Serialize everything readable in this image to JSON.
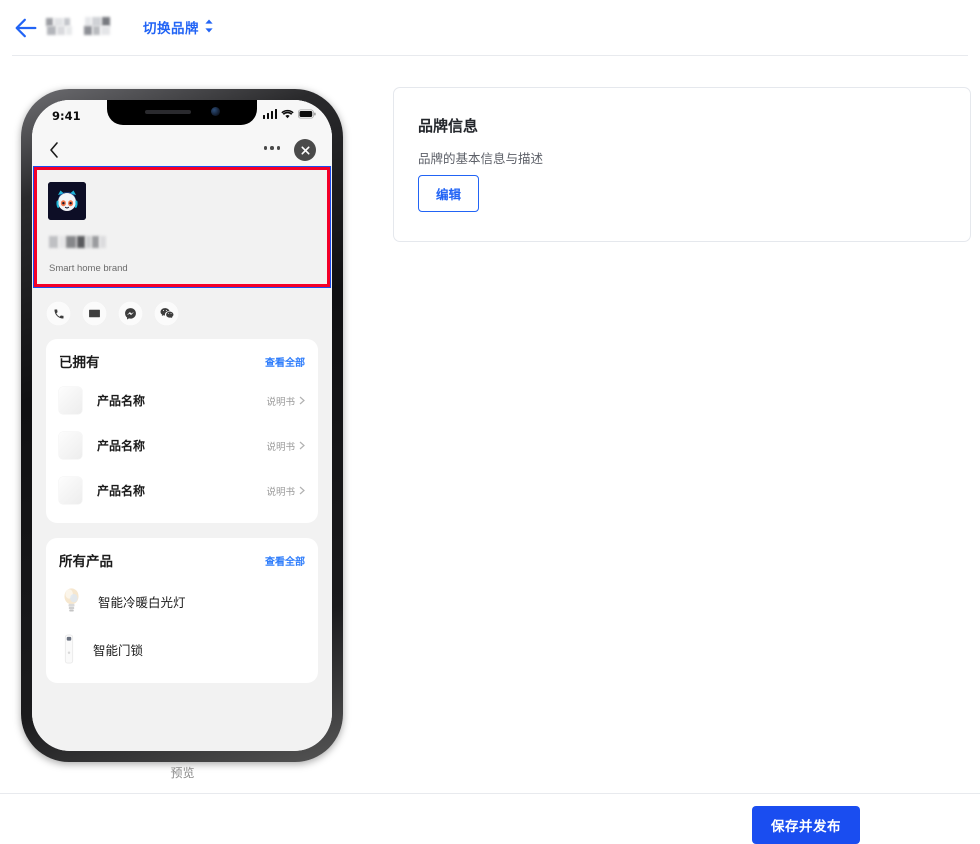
{
  "header": {
    "back_icon": "arrow-left-icon",
    "brand_logo_placeholder": "blurred-logo",
    "brand_text_placeholder": "blurred-brand-text",
    "switch_brand_label": "切换品牌",
    "switch_brand_icon": "unfold-more-icon",
    "accent_color": "#2264f5"
  },
  "preview": {
    "caption": "预览",
    "phone": {
      "status_bar": {
        "time": "9:41",
        "signal_icon": "cellular-signal-icon",
        "wifi_icon": "wifi-icon",
        "battery_icon": "battery-full-icon"
      },
      "nav": {
        "back_icon": "chevron-left-icon",
        "more_icon": "more-horizontal-icon",
        "close_icon": "close-circle-icon"
      },
      "brand_header": {
        "avatar_icon": "brand-avatar-cat-helmet",
        "name_placeholder": "blurred-brand-name",
        "description": "Smart home brand",
        "highlight_border_color": "#f40028",
        "highlight_outline_color": "#1a4df0"
      },
      "contacts": [
        {
          "icon": "phone-icon",
          "label": "电话"
        },
        {
          "icon": "email-icon",
          "label": "邮件"
        },
        {
          "icon": "messenger-icon",
          "label": "Messenger"
        },
        {
          "icon": "wechat-icon",
          "label": "微信"
        }
      ],
      "owned_section": {
        "title": "已拥有",
        "view_all": "查看全部",
        "items": [
          {
            "name": "产品名称",
            "action": "说明书",
            "chevron": "chevron-right-icon"
          },
          {
            "name": "产品名称",
            "action": "说明书",
            "chevron": "chevron-right-icon"
          },
          {
            "name": "产品名称",
            "action": "说明书",
            "chevron": "chevron-right-icon"
          }
        ]
      },
      "all_products_section": {
        "title": "所有产品",
        "view_all": "查看全部",
        "items": [
          {
            "name": "智能冷暖白光灯",
            "icon": "light-bulb-icon"
          },
          {
            "name": "智能门锁",
            "icon": "door-lock-icon"
          }
        ]
      }
    }
  },
  "brand_info_card": {
    "title": "品牌信息",
    "subtitle": "品牌的基本信息与描述",
    "edit_label": "编辑"
  },
  "footer": {
    "save_label": "保存并发布",
    "save_color": "#1a4df0"
  }
}
